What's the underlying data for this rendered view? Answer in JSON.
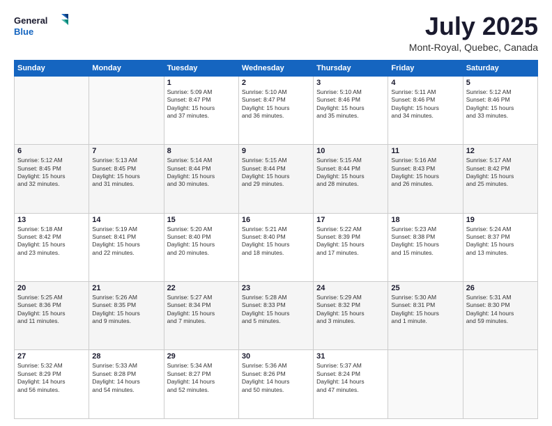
{
  "header": {
    "logo_line1": "General",
    "logo_line2": "Blue",
    "title": "July 2025",
    "subtitle": "Mont-Royal, Quebec, Canada"
  },
  "weekdays": [
    "Sunday",
    "Monday",
    "Tuesday",
    "Wednesday",
    "Thursday",
    "Friday",
    "Saturday"
  ],
  "weeks": [
    [
      {
        "day": "",
        "info": ""
      },
      {
        "day": "",
        "info": ""
      },
      {
        "day": "1",
        "info": "Sunrise: 5:09 AM\nSunset: 8:47 PM\nDaylight: 15 hours\nand 37 minutes."
      },
      {
        "day": "2",
        "info": "Sunrise: 5:10 AM\nSunset: 8:47 PM\nDaylight: 15 hours\nand 36 minutes."
      },
      {
        "day": "3",
        "info": "Sunrise: 5:10 AM\nSunset: 8:46 PM\nDaylight: 15 hours\nand 35 minutes."
      },
      {
        "day": "4",
        "info": "Sunrise: 5:11 AM\nSunset: 8:46 PM\nDaylight: 15 hours\nand 34 minutes."
      },
      {
        "day": "5",
        "info": "Sunrise: 5:12 AM\nSunset: 8:46 PM\nDaylight: 15 hours\nand 33 minutes."
      }
    ],
    [
      {
        "day": "6",
        "info": "Sunrise: 5:12 AM\nSunset: 8:45 PM\nDaylight: 15 hours\nand 32 minutes."
      },
      {
        "day": "7",
        "info": "Sunrise: 5:13 AM\nSunset: 8:45 PM\nDaylight: 15 hours\nand 31 minutes."
      },
      {
        "day": "8",
        "info": "Sunrise: 5:14 AM\nSunset: 8:44 PM\nDaylight: 15 hours\nand 30 minutes."
      },
      {
        "day": "9",
        "info": "Sunrise: 5:15 AM\nSunset: 8:44 PM\nDaylight: 15 hours\nand 29 minutes."
      },
      {
        "day": "10",
        "info": "Sunrise: 5:15 AM\nSunset: 8:44 PM\nDaylight: 15 hours\nand 28 minutes."
      },
      {
        "day": "11",
        "info": "Sunrise: 5:16 AM\nSunset: 8:43 PM\nDaylight: 15 hours\nand 26 minutes."
      },
      {
        "day": "12",
        "info": "Sunrise: 5:17 AM\nSunset: 8:42 PM\nDaylight: 15 hours\nand 25 minutes."
      }
    ],
    [
      {
        "day": "13",
        "info": "Sunrise: 5:18 AM\nSunset: 8:42 PM\nDaylight: 15 hours\nand 23 minutes."
      },
      {
        "day": "14",
        "info": "Sunrise: 5:19 AM\nSunset: 8:41 PM\nDaylight: 15 hours\nand 22 minutes."
      },
      {
        "day": "15",
        "info": "Sunrise: 5:20 AM\nSunset: 8:40 PM\nDaylight: 15 hours\nand 20 minutes."
      },
      {
        "day": "16",
        "info": "Sunrise: 5:21 AM\nSunset: 8:40 PM\nDaylight: 15 hours\nand 18 minutes."
      },
      {
        "day": "17",
        "info": "Sunrise: 5:22 AM\nSunset: 8:39 PM\nDaylight: 15 hours\nand 17 minutes."
      },
      {
        "day": "18",
        "info": "Sunrise: 5:23 AM\nSunset: 8:38 PM\nDaylight: 15 hours\nand 15 minutes."
      },
      {
        "day": "19",
        "info": "Sunrise: 5:24 AM\nSunset: 8:37 PM\nDaylight: 15 hours\nand 13 minutes."
      }
    ],
    [
      {
        "day": "20",
        "info": "Sunrise: 5:25 AM\nSunset: 8:36 PM\nDaylight: 15 hours\nand 11 minutes."
      },
      {
        "day": "21",
        "info": "Sunrise: 5:26 AM\nSunset: 8:35 PM\nDaylight: 15 hours\nand 9 minutes."
      },
      {
        "day": "22",
        "info": "Sunrise: 5:27 AM\nSunset: 8:34 PM\nDaylight: 15 hours\nand 7 minutes."
      },
      {
        "day": "23",
        "info": "Sunrise: 5:28 AM\nSunset: 8:33 PM\nDaylight: 15 hours\nand 5 minutes."
      },
      {
        "day": "24",
        "info": "Sunrise: 5:29 AM\nSunset: 8:32 PM\nDaylight: 15 hours\nand 3 minutes."
      },
      {
        "day": "25",
        "info": "Sunrise: 5:30 AM\nSunset: 8:31 PM\nDaylight: 15 hours\nand 1 minute."
      },
      {
        "day": "26",
        "info": "Sunrise: 5:31 AM\nSunset: 8:30 PM\nDaylight: 14 hours\nand 59 minutes."
      }
    ],
    [
      {
        "day": "27",
        "info": "Sunrise: 5:32 AM\nSunset: 8:29 PM\nDaylight: 14 hours\nand 56 minutes."
      },
      {
        "day": "28",
        "info": "Sunrise: 5:33 AM\nSunset: 8:28 PM\nDaylight: 14 hours\nand 54 minutes."
      },
      {
        "day": "29",
        "info": "Sunrise: 5:34 AM\nSunset: 8:27 PM\nDaylight: 14 hours\nand 52 minutes."
      },
      {
        "day": "30",
        "info": "Sunrise: 5:36 AM\nSunset: 8:26 PM\nDaylight: 14 hours\nand 50 minutes."
      },
      {
        "day": "31",
        "info": "Sunrise: 5:37 AM\nSunset: 8:24 PM\nDaylight: 14 hours\nand 47 minutes."
      },
      {
        "day": "",
        "info": ""
      },
      {
        "day": "",
        "info": ""
      }
    ]
  ]
}
